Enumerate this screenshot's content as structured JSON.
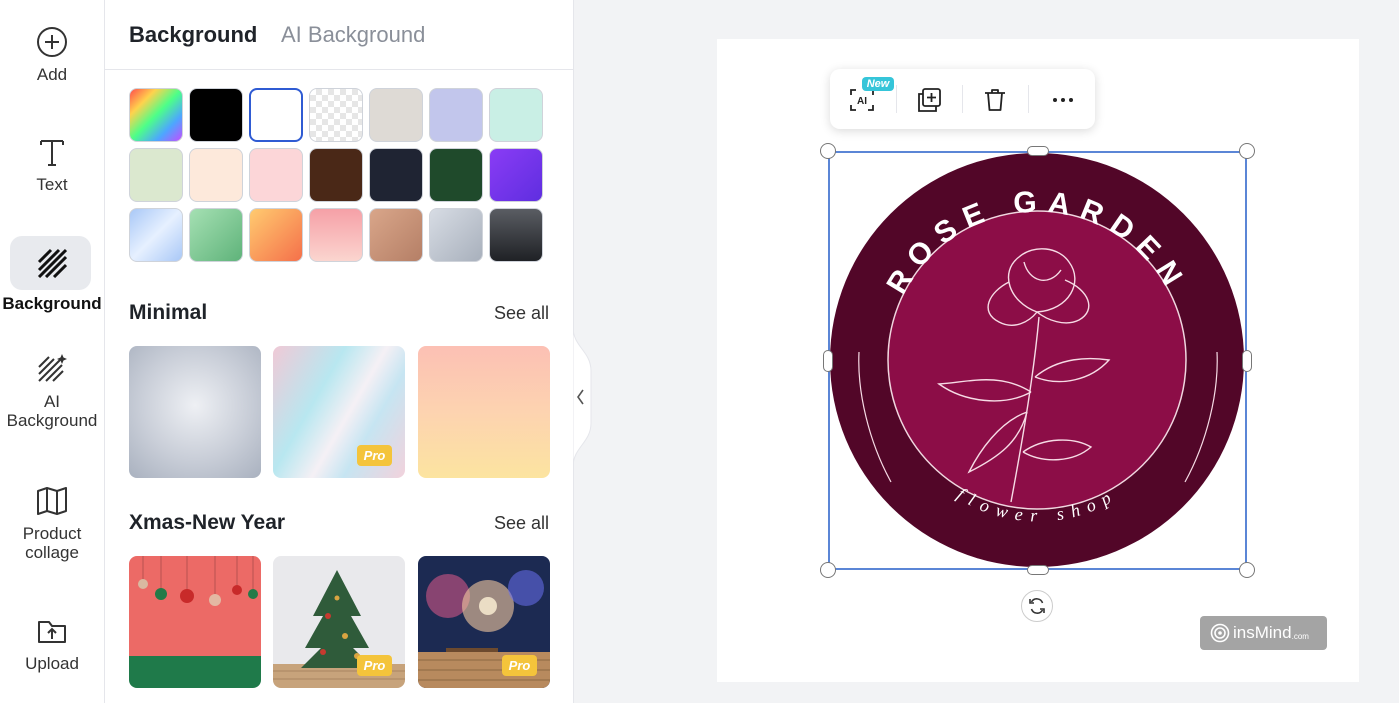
{
  "rail": {
    "items": [
      {
        "label": "Add",
        "icon": "plus-circle-icon"
      },
      {
        "label": "Text",
        "icon": "text-t-icon"
      },
      {
        "label": "Background",
        "icon": "hatch-background-icon"
      },
      {
        "label_line1": "AI",
        "label_line2": "Background",
        "icon": "ai-background-icon"
      },
      {
        "label_line1": "Product",
        "label_line2": "collage",
        "icon": "collage-map-icon"
      },
      {
        "label": "Upload",
        "icon": "upload-icon"
      }
    ]
  },
  "panel": {
    "tabs": [
      {
        "label": "Background",
        "active": true
      },
      {
        "label": "AI Background",
        "active": false
      }
    ],
    "swatches": [
      {
        "name": "rainbow",
        "fill": "linear-gradient(135deg,#ff4d4d,#ffd24d,#4dff88,#4da6ff,#c44dff)"
      },
      {
        "name": "black",
        "fill": "#000000"
      },
      {
        "name": "white",
        "fill": "#ffffff",
        "selected": true
      },
      {
        "name": "transparent",
        "fill": "checker"
      },
      {
        "name": "warm-gray",
        "fill": "#dedad5"
      },
      {
        "name": "periwinkle",
        "fill": "#c2c6ec"
      },
      {
        "name": "mint",
        "fill": "#c9efe5"
      },
      {
        "name": "pale-green",
        "fill": "#dbe8cf"
      },
      {
        "name": "peach",
        "fill": "#fde9db"
      },
      {
        "name": "pink",
        "fill": "#fcd6d8"
      },
      {
        "name": "brown",
        "fill": "#4a2817"
      },
      {
        "name": "navy",
        "fill": "#1f2433"
      },
      {
        "name": "forest",
        "fill": "#1f4a2b"
      },
      {
        "name": "violet",
        "fill": "linear-gradient(135deg,#8a3cf5,#5f2ee0)"
      },
      {
        "name": "sky-gradient",
        "fill": "linear-gradient(135deg,#a9c8f7,#e6f0ff,#a9c8f7)"
      },
      {
        "name": "green-gradient",
        "fill": "linear-gradient(135deg,#a5e0b3,#5fb37a)"
      },
      {
        "name": "orange-gradient",
        "fill": "linear-gradient(135deg,#ffcb70,#f5704a)"
      },
      {
        "name": "rose-gradient",
        "fill": "linear-gradient(180deg,#f6a0a7,#fbd5cf)"
      },
      {
        "name": "tan-gradient",
        "fill": "linear-gradient(135deg,#d9a68a,#b57f66)"
      },
      {
        "name": "silver-gradient",
        "fill": "linear-gradient(135deg,#d7dce4,#a8b0bc)"
      },
      {
        "name": "charcoal-gradient",
        "fill": "linear-gradient(180deg,#5a5d63,#1f2125)"
      }
    ],
    "sections": [
      {
        "title": "Minimal",
        "see_all": "See all",
        "thumbs": [
          {
            "name": "gray-radial",
            "pro": false
          },
          {
            "name": "iridescent",
            "pro": true
          },
          {
            "name": "peach-yellow",
            "pro": false
          }
        ]
      },
      {
        "title": "Xmas-New Year",
        "see_all": "See all",
        "thumbs": [
          {
            "name": "ornaments",
            "pro": false
          },
          {
            "name": "xmas-tree",
            "pro": true
          },
          {
            "name": "fireworks",
            "pro": true
          }
        ]
      }
    ],
    "pro_label": "Pro"
  },
  "toolbar": {
    "new_badge": "New",
    "ai_label": "AI",
    "buttons": [
      "ai-select-icon",
      "duplicate-icon",
      "trash-icon",
      "more-icon"
    ]
  },
  "logo": {
    "top_text": "ROSE GARDEN",
    "bottom_text": "flower shop",
    "outer_color": "#520628",
    "inner_color": "#8c0d47"
  },
  "watermark": {
    "brand": "insMind",
    "suffix": ".com"
  }
}
